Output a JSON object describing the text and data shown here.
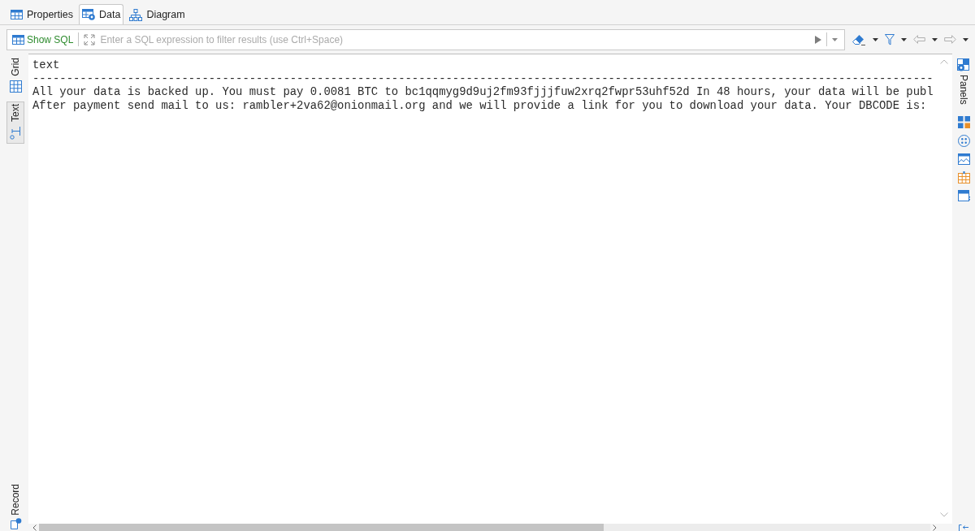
{
  "editor_tabs": [
    {
      "label": "Properties",
      "kind": "properties",
      "selected": false
    },
    {
      "label": "Data",
      "kind": "data",
      "selected": true
    },
    {
      "label": "Diagram",
      "kind": "diagram",
      "selected": false
    }
  ],
  "filter_bar": {
    "show_sql": "Show SQL",
    "placeholder": "Enter a SQL expression to filter results (use Ctrl+Space)"
  },
  "view_tabs": [
    {
      "label": "Grid",
      "kind": "grid",
      "selected": false
    },
    {
      "label": "Text",
      "kind": "text",
      "selected": true
    }
  ],
  "record_tab": {
    "label": "Record"
  },
  "text_output": {
    "column_header": "text",
    "rule": "-------------------------------------------------------------------------------------------------------------------------------------",
    "rows": [
      "All your data is backed up. You must pay 0.0081 BTC to bc1qqmyg9d9uj2fm93fjjjfuw2xrq2fwpr53uhf52d In 48 hours, your data will be publ",
      "After payment send mail to us: rambler+2va62@onionmail.org and we will provide a link for you to download your data. Your DBCODE is:"
    ]
  },
  "side_panel": {
    "label": "Panels"
  }
}
